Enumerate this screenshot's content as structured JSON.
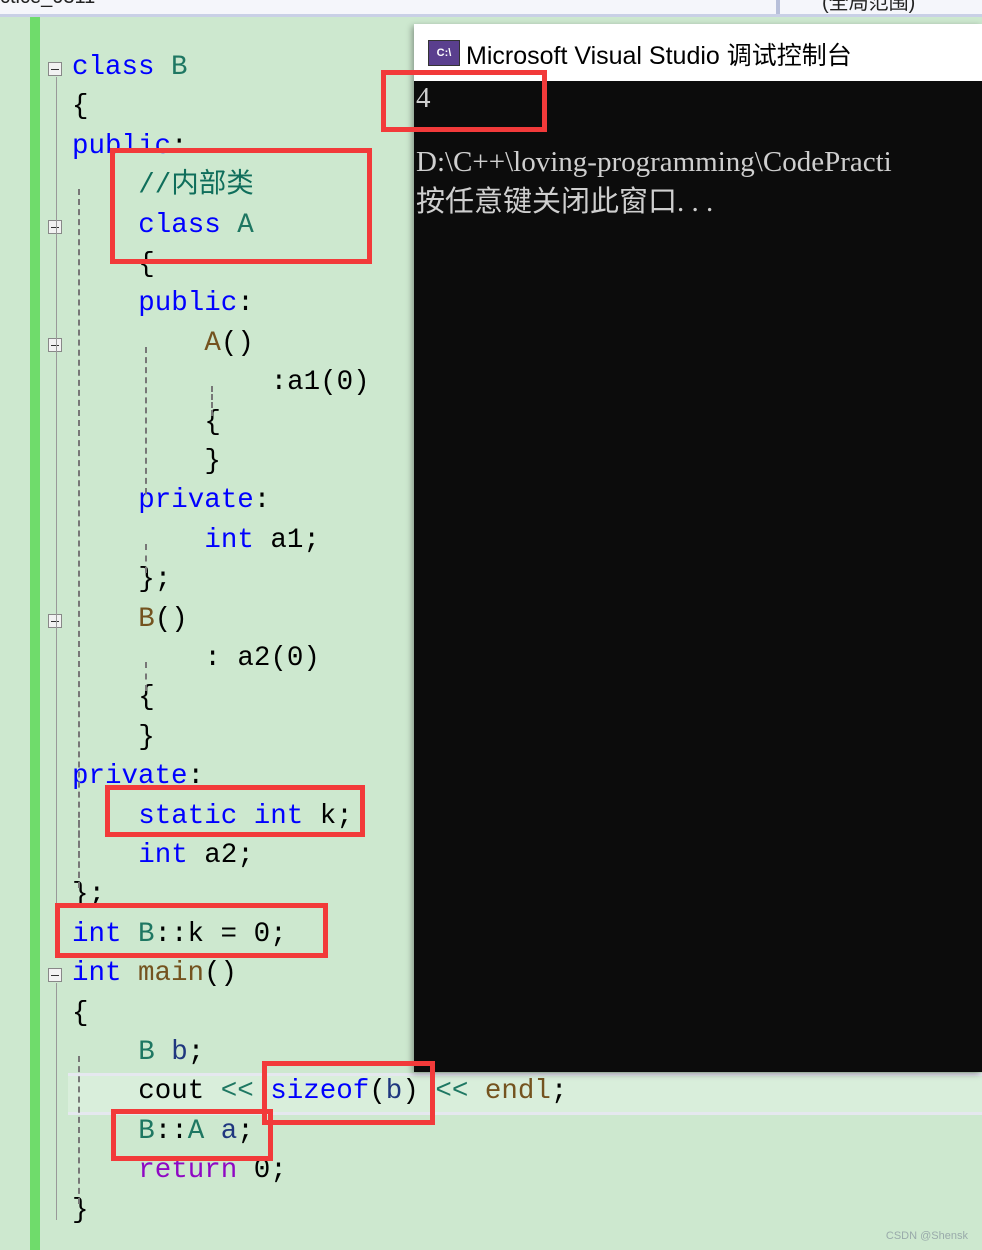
{
  "tabbar": {
    "file_tab": "ctice_0311",
    "scope": "(全局范围)"
  },
  "console": {
    "title": "Microsoft Visual Studio 调试控制台",
    "icon": "console-app-icon",
    "icon_text": "C:\\",
    "output": [
      "4",
      "",
      "D:\\C++\\loving-programming\\CodePracti",
      "按任意键关闭此窗口. . ."
    ]
  },
  "code": [
    {
      "c": 0,
      "t": [
        [
          "class",
          "kw"
        ],
        [
          " ",
          "p"
        ],
        [
          "B",
          "cls"
        ]
      ]
    },
    {
      "c": 0,
      "t": [
        [
          "{",
          "p"
        ]
      ]
    },
    {
      "c": 0,
      "t": [
        [
          "public",
          "kw"
        ],
        [
          ":",
          "p"
        ]
      ]
    },
    {
      "c": 4,
      "t": [
        [
          "//内部类",
          "cm"
        ]
      ]
    },
    {
      "c": 4,
      "t": [
        [
          "class",
          "kw"
        ],
        [
          " ",
          "p"
        ],
        [
          "A",
          "cls"
        ]
      ]
    },
    {
      "c": 4,
      "t": [
        [
          "{",
          "p"
        ]
      ]
    },
    {
      "c": 4,
      "t": [
        [
          "public",
          "kw"
        ],
        [
          ":",
          "p"
        ]
      ]
    },
    {
      "c": 8,
      "t": [
        [
          "A",
          "fn"
        ],
        [
          "()",
          "p"
        ]
      ]
    },
    {
      "c": 12,
      "t": [
        [
          ":a1(",
          "p"
        ],
        [
          "0",
          "p"
        ],
        [
          ")",
          "p"
        ]
      ]
    },
    {
      "c": 8,
      "t": [
        [
          "{",
          "p"
        ]
      ]
    },
    {
      "c": 8,
      "t": [
        [
          "}",
          "p"
        ]
      ]
    },
    {
      "c": 4,
      "t": [
        [
          "private",
          "kw"
        ],
        [
          ":",
          "p"
        ]
      ]
    },
    {
      "c": 8,
      "t": [
        [
          "int",
          "kw"
        ],
        [
          " a1;",
          "p"
        ]
      ]
    },
    {
      "c": 4,
      "t": [
        [
          "};",
          "p"
        ]
      ]
    },
    {
      "c": 4,
      "t": [
        [
          "B",
          "fn"
        ],
        [
          "()",
          "p"
        ]
      ]
    },
    {
      "c": 8,
      "t": [
        [
          ": a2(0)",
          "p"
        ]
      ]
    },
    {
      "c": 4,
      "t": [
        [
          "{",
          "p"
        ]
      ]
    },
    {
      "c": 4,
      "t": [
        [
          "}",
          "p"
        ]
      ]
    },
    {
      "c": 0,
      "t": [
        [
          "private",
          "kw"
        ],
        [
          ":",
          "p"
        ]
      ]
    },
    {
      "c": 4,
      "t": [
        [
          "static",
          "kw"
        ],
        [
          " ",
          "p"
        ],
        [
          "int",
          "kw"
        ],
        [
          " k;",
          "p"
        ]
      ]
    },
    {
      "c": 4,
      "t": [
        [
          "int",
          "kw"
        ],
        [
          " a2;",
          "p"
        ]
      ]
    },
    {
      "c": 0,
      "t": [
        [
          "};",
          "p"
        ]
      ]
    },
    {
      "c": 0,
      "t": [
        [
          "int",
          "kw"
        ],
        [
          " ",
          "p"
        ],
        [
          "B",
          "cls"
        ],
        [
          "::k = 0;",
          "p"
        ]
      ]
    },
    {
      "c": 0,
      "t": [
        [
          "int",
          "kw"
        ],
        [
          " ",
          "p"
        ],
        [
          "main",
          "fn"
        ],
        [
          "()",
          "p"
        ]
      ]
    },
    {
      "c": 0,
      "t": [
        [
          "{",
          "p"
        ]
      ]
    },
    {
      "c": 4,
      "t": [
        [
          "B",
          "cls"
        ],
        [
          " ",
          "p"
        ],
        [
          "b",
          "var"
        ],
        [
          ";",
          "p"
        ]
      ]
    },
    {
      "c": 4,
      "t": [
        [
          "cout",
          "p"
        ],
        [
          " ",
          "p"
        ],
        [
          "<<",
          "op"
        ],
        [
          " ",
          "p"
        ],
        [
          "sizeof",
          "kw"
        ],
        [
          "(",
          "p"
        ],
        [
          "b",
          "var"
        ],
        [
          ")",
          "p"
        ],
        [
          " ",
          "p"
        ],
        [
          "<<",
          "op"
        ],
        [
          " ",
          "p"
        ],
        [
          "endl",
          "fn"
        ],
        [
          ";",
          "p"
        ]
      ]
    },
    {
      "c": 4,
      "t": [
        [
          "B",
          "cls"
        ],
        [
          "::",
          "p"
        ],
        [
          "A",
          "cls"
        ],
        [
          " ",
          "p"
        ],
        [
          "a",
          "var"
        ],
        [
          ";",
          "p"
        ]
      ]
    },
    {
      "c": 4,
      "t": [
        [
          "return",
          "ret"
        ],
        [
          " 0;",
          "p"
        ]
      ]
    },
    {
      "c": 0,
      "t": [
        [
          "}",
          "p"
        ]
      ]
    }
  ],
  "watermark": "CSDN @Shensk",
  "colors": {
    "highlight_box": "#f23a3a",
    "editor_bg": "#cde8cf",
    "change_bar": "#6fdc6b"
  }
}
